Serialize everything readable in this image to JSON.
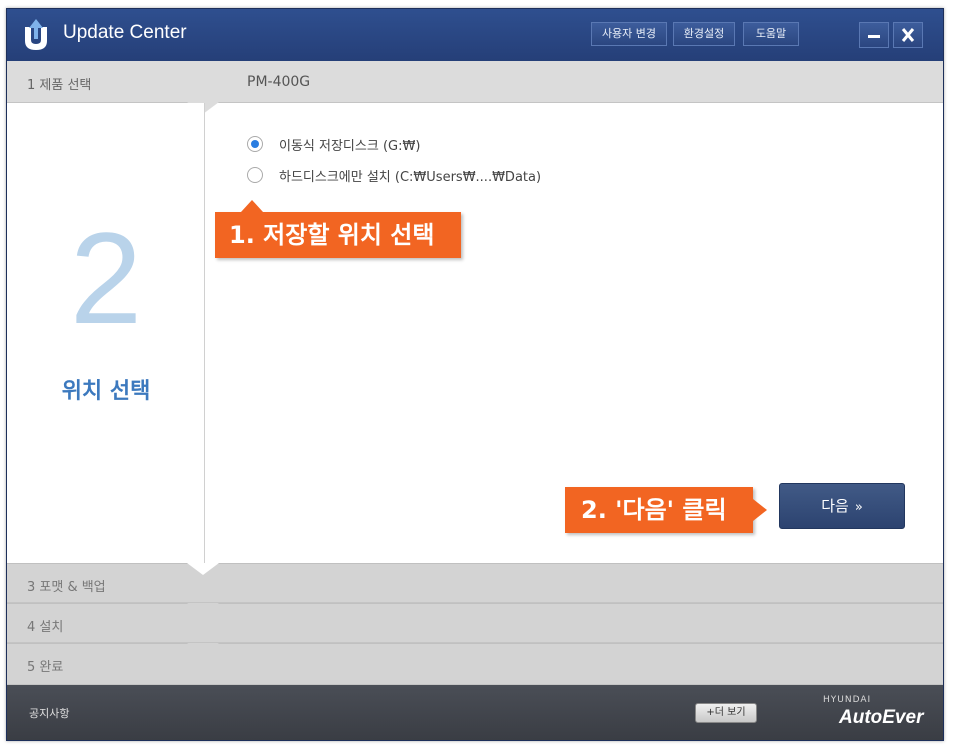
{
  "app": {
    "title_prefix": "Update",
    "title_suffix": " Center",
    "header_buttons": {
      "user_change": "사용자 변경",
      "settings": "환경설정",
      "help": "도움말"
    }
  },
  "steps": {
    "step1": {
      "label": "1  제품 선택",
      "product": "PM-400G"
    },
    "current": {
      "number": "2",
      "title": "위치 선택"
    },
    "step3": {
      "label": "3  포맷 & 백업"
    },
    "step4": {
      "label": "4  설치"
    },
    "step5": {
      "label": "5  완료"
    }
  },
  "options": [
    {
      "label": "이동식 저장디스크 (G:₩)",
      "selected": true
    },
    {
      "label": "하드디스크에만 설치 (C:₩Users₩....₩Data)",
      "selected": false
    }
  ],
  "callouts": {
    "first": "1. 저장할 위치 선택",
    "second": "2. '다음' 클릭"
  },
  "next_button": {
    "label": "다음",
    "icon": "double-chevron-down-icon"
  },
  "footer": {
    "notice": "공지사항",
    "more": "+더 보기",
    "brand_top": "HYUNDAI",
    "brand_main": "AutoEver"
  },
  "colors": {
    "accent": "#3c79be",
    "callout": "#f26522",
    "titlebar": "#2b4680"
  }
}
